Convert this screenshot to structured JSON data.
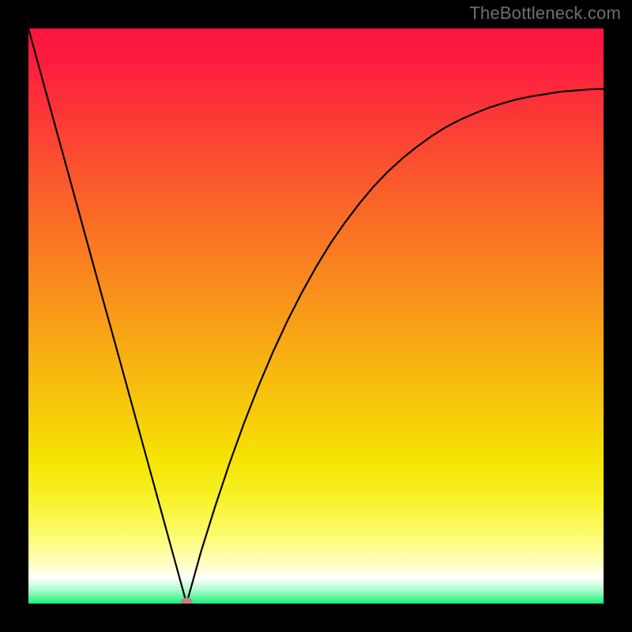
{
  "watermark": "TheBottleneck.com",
  "chart_data": {
    "type": "line",
    "title": "",
    "xlabel": "",
    "ylabel": "",
    "xlim": [
      0,
      1
    ],
    "ylim": [
      0,
      1
    ],
    "grid": false,
    "x_minimum": 0.275,
    "series": [
      {
        "name": "curve",
        "x": [
          0.0,
          0.025,
          0.05,
          0.075,
          0.1,
          0.125,
          0.15,
          0.175,
          0.2,
          0.225,
          0.25,
          0.275,
          0.3,
          0.325,
          0.35,
          0.375,
          0.4,
          0.425,
          0.45,
          0.475,
          0.5,
          0.525,
          0.55,
          0.575,
          0.6,
          0.625,
          0.65,
          0.675,
          0.7,
          0.725,
          0.75,
          0.775,
          0.8,
          0.825,
          0.85,
          0.875,
          0.9,
          0.925,
          0.95,
          0.975,
          1.0
        ],
        "y": [
          1.0,
          0.909,
          0.818,
          0.727,
          0.636,
          0.545,
          0.455,
          0.364,
          0.273,
          0.182,
          0.091,
          0.0,
          0.09,
          0.17,
          0.245,
          0.314,
          0.378,
          0.437,
          0.491,
          0.54,
          0.585,
          0.626,
          0.662,
          0.695,
          0.725,
          0.751,
          0.774,
          0.794,
          0.812,
          0.828,
          0.841,
          0.852,
          0.862,
          0.87,
          0.877,
          0.882,
          0.886,
          0.89,
          0.892,
          0.894,
          0.895
        ]
      }
    ],
    "marker": {
      "x": 0.275,
      "y": 0.0,
      "color": "#c18080"
    },
    "background_gradient": {
      "stops": [
        {
          "offset": 0.0,
          "color": "#fd1441"
        },
        {
          "offset": 0.06,
          "color": "#fc1e3e"
        },
        {
          "offset": 0.18,
          "color": "#fb4034"
        },
        {
          "offset": 0.3,
          "color": "#fa6329"
        },
        {
          "offset": 0.42,
          "color": "#f9851f"
        },
        {
          "offset": 0.54,
          "color": "#f8a715"
        },
        {
          "offset": 0.66,
          "color": "#f6c90b"
        },
        {
          "offset": 0.75,
          "color": "#f5e403"
        },
        {
          "offset": 0.82,
          "color": "#f8f22c"
        },
        {
          "offset": 0.88,
          "color": "#fbfc6d"
        },
        {
          "offset": 0.93,
          "color": "#fffec0"
        },
        {
          "offset": 0.955,
          "color": "#ffffff"
        },
        {
          "offset": 0.975,
          "color": "#b3fccf"
        },
        {
          "offset": 0.99,
          "color": "#5af69d"
        },
        {
          "offset": 1.0,
          "color": "#16f180"
        }
      ]
    }
  }
}
